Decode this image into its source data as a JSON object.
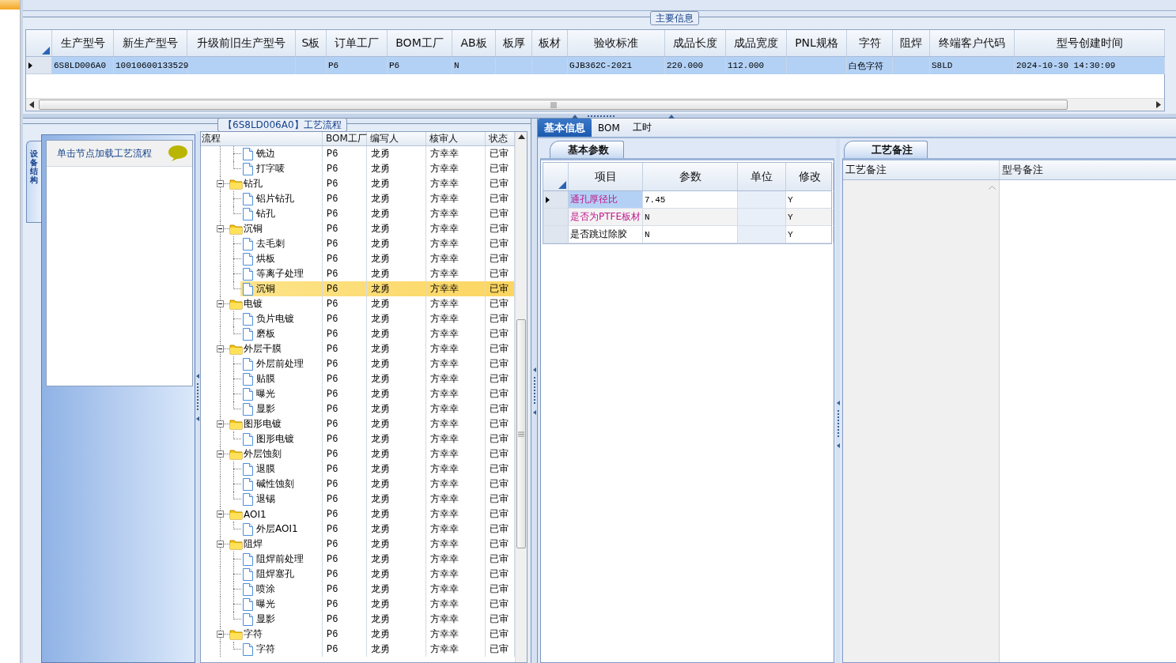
{
  "main_info": {
    "title": "主要信息",
    "columns": [
      "生产型号",
      "新生产型号",
      "升级前旧生产型号",
      "S板",
      "订单工厂",
      "BOM工厂",
      "AB板",
      "板厚",
      "板材",
      "验收标准",
      "成品长度",
      "成品宽度",
      "PNL规格",
      "字符",
      "阻焊",
      "终端客户代码",
      "型号创建时间"
    ],
    "rows": [
      {
        "selected": true,
        "cells": [
          "6S8LD006A0",
          "10010600133529",
          null,
          null,
          "P6",
          "P6",
          "N",
          null,
          null,
          "GJB362C-2021",
          "220.000",
          "112.000",
          null,
          "白色字符",
          null,
          "S8LD",
          "2024-10-30 14:30:09"
        ]
      }
    ]
  },
  "process_panel": {
    "title": "【6S8LD006A0】工艺流程",
    "side_tab": "设备结构",
    "hint": "单击节点加载工艺流程",
    "columns": [
      "流程",
      "BOM工厂",
      "编写人",
      "核审人",
      "状态"
    ],
    "tree": [
      {
        "kind": "step",
        "name": "铣边",
        "factory": "P6",
        "writer": "龙勇",
        "reviewer": "方幸幸",
        "status": "已审",
        "selected": false
      },
      {
        "kind": "step",
        "name": "打字唛",
        "factory": "P6",
        "writer": "龙勇",
        "reviewer": "方幸幸",
        "status": "已审",
        "selected": false
      },
      {
        "kind": "folder",
        "name": "钻孔",
        "factory": "P6",
        "writer": "龙勇",
        "reviewer": "方幸幸",
        "status": "已审",
        "selected": false,
        "expanded": true,
        "children": [
          {
            "kind": "step",
            "name": "铝片钻孔",
            "factory": "P6",
            "writer": "龙勇",
            "reviewer": "方幸幸",
            "status": "已审",
            "selected": false
          },
          {
            "kind": "step",
            "name": "钻孔",
            "factory": "P6",
            "writer": "龙勇",
            "reviewer": "方幸幸",
            "status": "已审",
            "selected": false
          }
        ]
      },
      {
        "kind": "folder",
        "name": "沉铜",
        "factory": "P6",
        "writer": "龙勇",
        "reviewer": "方幸幸",
        "status": "已审",
        "selected": false,
        "expanded": true,
        "children": [
          {
            "kind": "step",
            "name": "去毛刺",
            "factory": "P6",
            "writer": "龙勇",
            "reviewer": "方幸幸",
            "status": "已审",
            "selected": false
          },
          {
            "kind": "step",
            "name": "烘板",
            "factory": "P6",
            "writer": "龙勇",
            "reviewer": "方幸幸",
            "status": "已审",
            "selected": false
          },
          {
            "kind": "step",
            "name": "等离子处理",
            "factory": "P6",
            "writer": "龙勇",
            "reviewer": "方幸幸",
            "status": "已审",
            "selected": false
          },
          {
            "kind": "step",
            "name": "沉铜",
            "factory": "P6",
            "writer": "龙勇",
            "reviewer": "方幸幸",
            "status": "已审",
            "selected": true
          }
        ]
      },
      {
        "kind": "folder",
        "name": "电镀",
        "factory": "P6",
        "writer": "龙勇",
        "reviewer": "方幸幸",
        "status": "已审",
        "selected": false,
        "expanded": true,
        "children": [
          {
            "kind": "step",
            "name": "负片电镀",
            "factory": "P6",
            "writer": "龙勇",
            "reviewer": "方幸幸",
            "status": "已审",
            "selected": false
          },
          {
            "kind": "step",
            "name": "磨板",
            "factory": "P6",
            "writer": "龙勇",
            "reviewer": "方幸幸",
            "status": "已审",
            "selected": false
          }
        ]
      },
      {
        "kind": "folder",
        "name": "外层干膜",
        "factory": "P6",
        "writer": "龙勇",
        "reviewer": "方幸幸",
        "status": "已审",
        "selected": false,
        "expanded": true,
        "children": [
          {
            "kind": "step",
            "name": "外层前处理",
            "factory": "P6",
            "writer": "龙勇",
            "reviewer": "方幸幸",
            "status": "已审",
            "selected": false
          },
          {
            "kind": "step",
            "name": "贴膜",
            "factory": "P6",
            "writer": "龙勇",
            "reviewer": "方幸幸",
            "status": "已审",
            "selected": false
          },
          {
            "kind": "step",
            "name": "曝光",
            "factory": "P6",
            "writer": "龙勇",
            "reviewer": "方幸幸",
            "status": "已审",
            "selected": false
          },
          {
            "kind": "step",
            "name": "显影",
            "factory": "P6",
            "writer": "龙勇",
            "reviewer": "方幸幸",
            "status": "已审",
            "selected": false
          }
        ]
      },
      {
        "kind": "folder",
        "name": "图形电镀",
        "factory": "P6",
        "writer": "龙勇",
        "reviewer": "方幸幸",
        "status": "已审",
        "selected": false,
        "expanded": true,
        "children": [
          {
            "kind": "step",
            "name": "图形电镀",
            "factory": "P6",
            "writer": "龙勇",
            "reviewer": "方幸幸",
            "status": "已审",
            "selected": false
          }
        ]
      },
      {
        "kind": "folder",
        "name": "外层蚀刻",
        "factory": "P6",
        "writer": "龙勇",
        "reviewer": "方幸幸",
        "status": "已审",
        "selected": false,
        "expanded": true,
        "children": [
          {
            "kind": "step",
            "name": "退膜",
            "factory": "P6",
            "writer": "龙勇",
            "reviewer": "方幸幸",
            "status": "已审",
            "selected": false
          },
          {
            "kind": "step",
            "name": "碱性蚀刻",
            "factory": "P6",
            "writer": "龙勇",
            "reviewer": "方幸幸",
            "status": "已审",
            "selected": false
          },
          {
            "kind": "step",
            "name": "退锡",
            "factory": "P6",
            "writer": "龙勇",
            "reviewer": "方幸幸",
            "status": "已审",
            "selected": false
          }
        ]
      },
      {
        "kind": "folder",
        "name": "AOI1",
        "factory": "P6",
        "writer": "龙勇",
        "reviewer": "方幸幸",
        "status": "已审",
        "selected": false,
        "expanded": true,
        "children": [
          {
            "kind": "step",
            "name": "外层AOI1",
            "factory": "P6",
            "writer": "龙勇",
            "reviewer": "方幸幸",
            "status": "已审",
            "selected": false
          }
        ]
      },
      {
        "kind": "folder",
        "name": "阻焊",
        "factory": "P6",
        "writer": "龙勇",
        "reviewer": "方幸幸",
        "status": "已审",
        "selected": false,
        "expanded": true,
        "children": [
          {
            "kind": "step",
            "name": "阻焊前处理",
            "factory": "P6",
            "writer": "龙勇",
            "reviewer": "方幸幸",
            "status": "已审",
            "selected": false
          },
          {
            "kind": "step",
            "name": "阻焊塞孔",
            "factory": "P6",
            "writer": "龙勇",
            "reviewer": "方幸幸",
            "status": "已审",
            "selected": false
          },
          {
            "kind": "step",
            "name": "喷涂",
            "factory": "P6",
            "writer": "龙勇",
            "reviewer": "方幸幸",
            "status": "已审",
            "selected": false
          },
          {
            "kind": "step",
            "name": "曝光",
            "factory": "P6",
            "writer": "龙勇",
            "reviewer": "方幸幸",
            "status": "已审",
            "selected": false
          },
          {
            "kind": "step",
            "name": "显影",
            "factory": "P6",
            "writer": "龙勇",
            "reviewer": "方幸幸",
            "status": "已审",
            "selected": false
          }
        ]
      },
      {
        "kind": "folder",
        "name": "字符",
        "factory": "P6",
        "writer": "龙勇",
        "reviewer": "方幸幸",
        "status": "已审",
        "selected": false,
        "expanded": true,
        "children": [
          {
            "kind": "step",
            "name": "字符",
            "factory": "P6",
            "writer": "龙勇",
            "reviewer": "方幸幸",
            "status": "已审",
            "selected": false
          }
        ]
      }
    ]
  },
  "detail_tabs": [
    {
      "label": "基本信息",
      "selected": true
    },
    {
      "label": "BOM",
      "selected": false
    },
    {
      "label": "工时",
      "selected": false
    }
  ],
  "basic_params": {
    "tab": "基本参数",
    "columns": [
      "项目",
      "参数",
      "单位",
      "修改"
    ],
    "rows": [
      {
        "item": "通孔厚径比",
        "flagged": true,
        "value": "7.45",
        "modify": "Y",
        "selected": true
      },
      {
        "item": "是否为PTFE板材",
        "flagged": true,
        "value": "N",
        "modify": "Y",
        "selected": false
      },
      {
        "item": "是否跳过除胶",
        "flagged": false,
        "value": "N",
        "modify": "Y",
        "selected": false
      }
    ]
  },
  "process_notes": {
    "tab": "工艺备注",
    "columns": [
      "工艺备注",
      "型号备注"
    ]
  }
}
